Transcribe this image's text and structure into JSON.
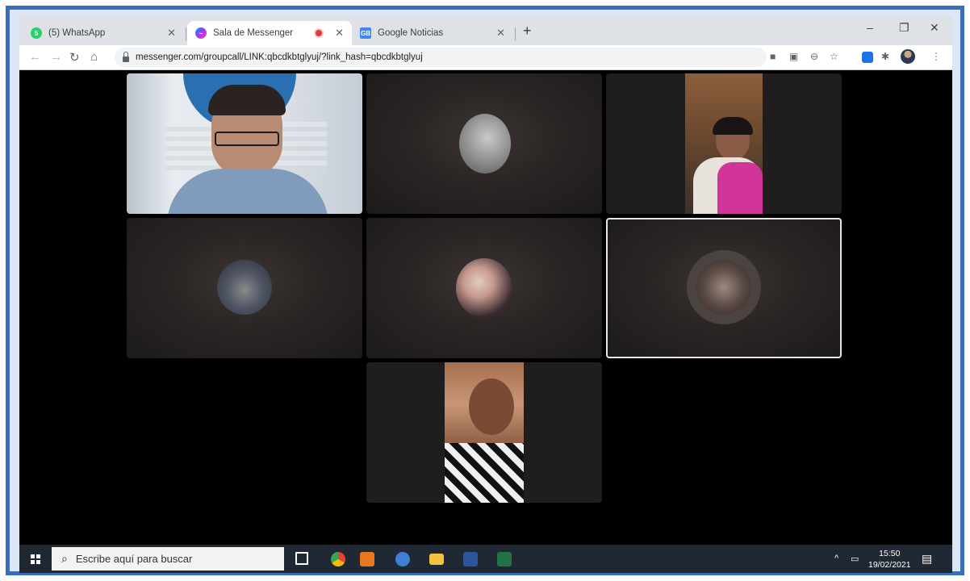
{
  "browser": {
    "tabs": [
      {
        "title": "(5) WhatsApp",
        "favicon": "whatsapp-icon",
        "color": "#25d366",
        "badge": "5"
      },
      {
        "title": "Sala de Messenger",
        "favicon": "messenger-icon",
        "color": "#8a3ffc",
        "active": true,
        "recording": true
      },
      {
        "title": "Google Noticias",
        "favicon": "google-news-icon",
        "color": "#4285f4",
        "badge": "GB"
      }
    ],
    "close_glyph": "✕",
    "new_tab_glyph": "+",
    "address": "messenger.com/groupcall/LINK:qbcdkbtglyuj/?link_hash=qbcdkbtglyuj",
    "window_controls": [
      "–",
      "❐",
      "✕"
    ]
  },
  "call": {
    "participants": [
      {
        "id": "p1",
        "video": true,
        "selected": false
      },
      {
        "id": "p2",
        "video": false,
        "selected": false
      },
      {
        "id": "p3",
        "video": true,
        "selected": false
      },
      {
        "id": "p4",
        "video": false,
        "selected": false
      },
      {
        "id": "p5",
        "video": false,
        "selected": false
      },
      {
        "id": "p6",
        "video": false,
        "selected": true
      },
      {
        "id": "p7",
        "video": true,
        "selected": false
      }
    ]
  },
  "taskbar": {
    "search_placeholder": "Escribe aquí para buscar",
    "time": "15:50",
    "date": "19/02/2021",
    "apps": [
      "task-view-icon",
      "chrome-icon",
      "media-player-icon",
      "app-icon",
      "file-explorer-icon",
      "word-icon",
      "excel-icon"
    ]
  },
  "colors": {
    "frame_border": "#3a6fb8",
    "taskbar": "#202833",
    "tab_strip": "#dee1e6"
  }
}
